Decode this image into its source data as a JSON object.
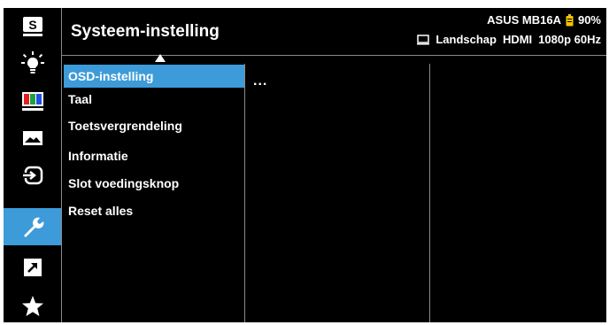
{
  "header": {
    "title": "Systeem-instelling",
    "model": "ASUS MB16A",
    "battery": "90%",
    "status": {
      "orientation": "Landschap",
      "input": "HDMI",
      "resolution": "1080p 60Hz"
    }
  },
  "sidebar": {
    "items": [
      {
        "icon": "splendid-s-icon"
      },
      {
        "icon": "blue-light-filter-icon"
      },
      {
        "icon": "color-icon"
      },
      {
        "icon": "image-icon"
      },
      {
        "icon": "input-select-icon"
      },
      {
        "icon": "system-setup-wrench-icon",
        "active": true
      },
      {
        "icon": "shortcut-arrow-icon"
      },
      {
        "icon": "myfavorite-star-icon"
      }
    ]
  },
  "menu": {
    "items": [
      {
        "label": "OSD-instelling",
        "selected": true
      },
      {
        "label": "Taal"
      },
      {
        "label": "Toetsvergrendeling"
      },
      {
        "label": "Informatie"
      },
      {
        "label": "Slot voedingsknop"
      },
      {
        "label": "Reset alles"
      }
    ],
    "submenu_placeholder": "..."
  },
  "colors": {
    "accent": "#3d9bd9",
    "battery": "#f5c400",
    "background": "#000000"
  }
}
